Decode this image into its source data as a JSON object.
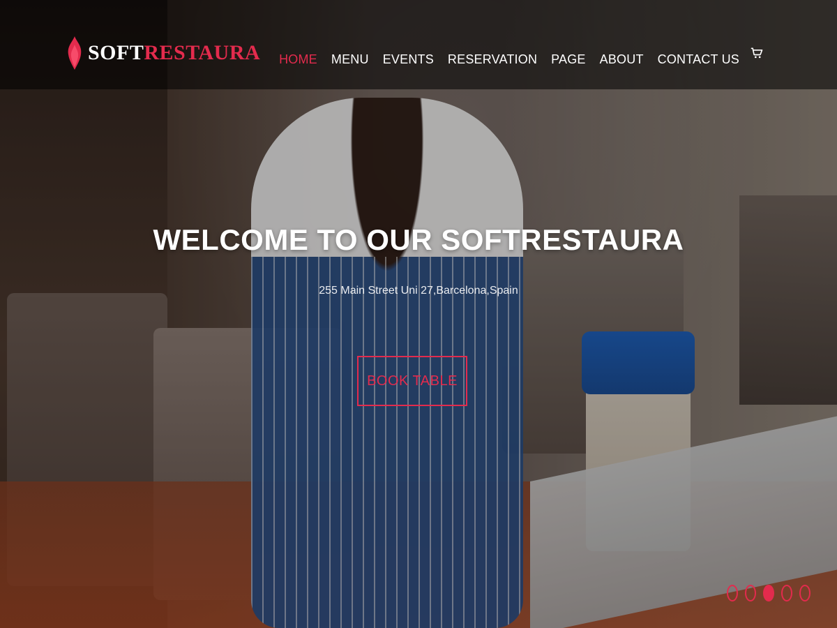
{
  "brand": {
    "name_part1": "SOFT",
    "name_part2": "RESTAURA",
    "colors": {
      "accent": "#e32b4d",
      "text": "#ffffff",
      "topbar_bg": "#000000"
    }
  },
  "nav": {
    "items": [
      {
        "label": "HOME",
        "active": true
      },
      {
        "label": "MENU",
        "active": false
      },
      {
        "label": "EVENTS",
        "active": false
      },
      {
        "label": "RESERVATION",
        "active": false
      },
      {
        "label": "PAGE",
        "active": false
      },
      {
        "label": "ABOUT",
        "active": false
      },
      {
        "label": "CONTACT US",
        "active": false
      }
    ],
    "cart_icon": "shopping-cart-icon"
  },
  "hero": {
    "title": "WELCOME TO OUR SOFTRESTAURA",
    "subtitle": "255 Main Street Uni 27,Barcelona,Spain",
    "cta_label": "BOOK TABLE"
  },
  "slider": {
    "dots_count": 5,
    "active_index": 2
  }
}
